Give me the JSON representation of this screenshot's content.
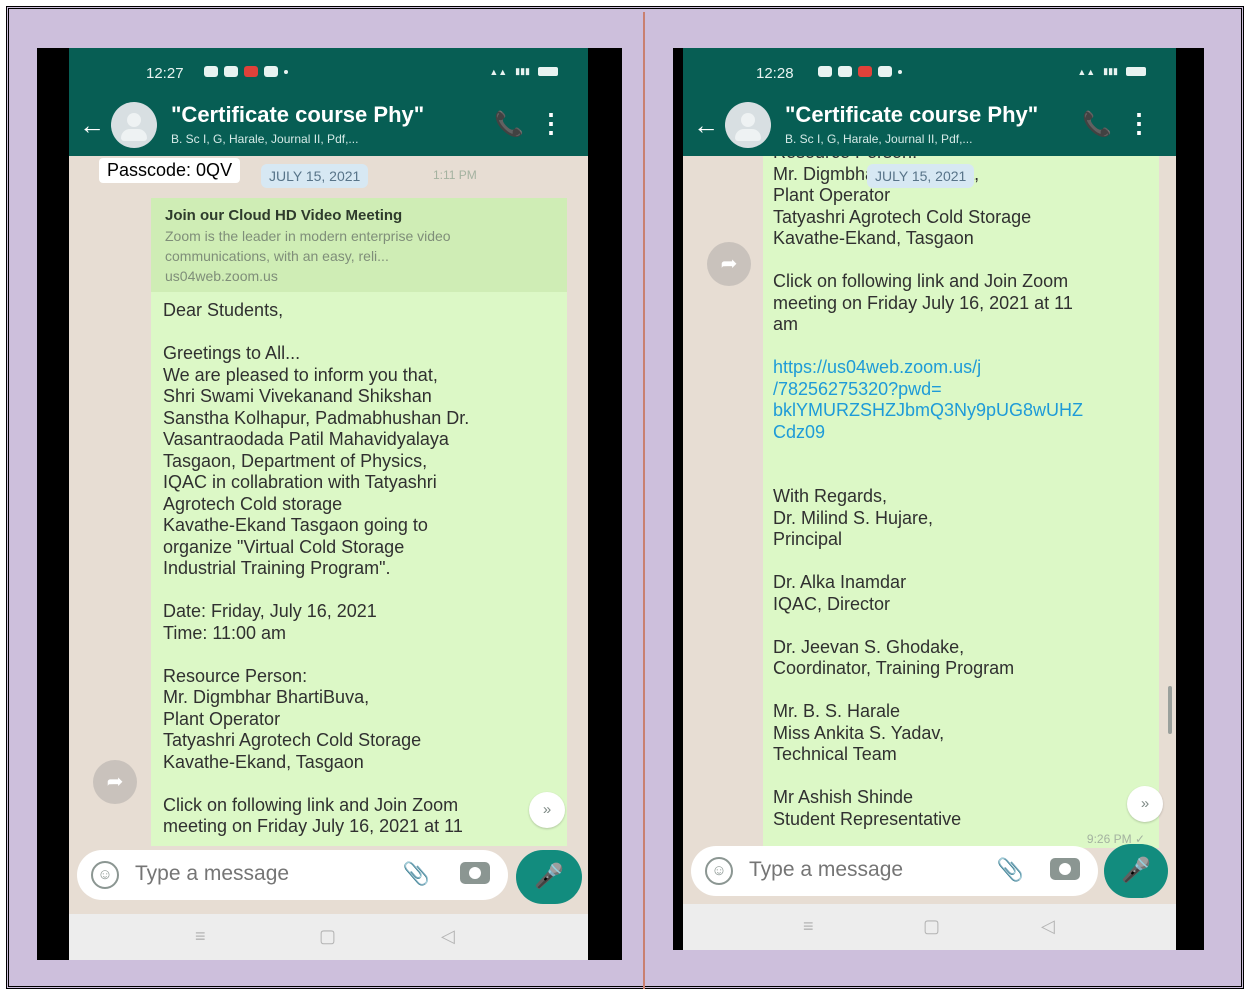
{
  "left": {
    "status_time": "12:27",
    "chat_title": "\"Certificate course Phy\"",
    "chat_subtitle": "B. Sc I, G, Harale, Journal II, Pdf,...",
    "passcode": "Passcode: 0QV",
    "date_chip": "JULY 15, 2021",
    "chip_time": "1:11 PM",
    "preview_title": "Join our Cloud HD Video Meeting",
    "preview_desc": "Zoom is the leader in modern enterprise video communications, with an easy, reli...",
    "preview_domain": "us04web.zoom.us",
    "message_lines": [
      "Dear Students,",
      "",
      "Greetings to All...",
      "We are pleased to inform you that,",
      "Shri Swami Vivekanand Shikshan",
      "Sanstha Kolhapur, Padmabhushan Dr.",
      "Vasantraodada Patil Mahavidyalaya",
      "Tasgaon, Department of Physics,",
      "IQAC in collabration with Tatyashri",
      "Agrotech Cold storage",
      "Kavathe-Ekand Tasgaon  going to",
      "organize \"Virtual Cold Storage",
      "Industrial Training Program\".",
      "",
      "Date: Friday, July 16, 2021",
      "Time: 11:00 am",
      "",
      "Resource Person:",
      "Mr. Digmbhar BhartiBuva,",
      "Plant Operator",
      "Tatyashri Agrotech Cold Storage",
      "Kavathe-Ekand, Tasgaon",
      "",
      "Click on following link and Join Zoom",
      "meeting on Friday July 16, 2021 at 11"
    ],
    "input_placeholder": "Type a message"
  },
  "right": {
    "status_time": "12:28",
    "chat_title": "\"Certificate course Phy\"",
    "chat_subtitle": "B. Sc I, G, Harale, Journal II, Pdf,...",
    "date_chip": "JULY 15, 2021",
    "message_lines": [
      "Resource Person:",
      "Mr. Digmbhar BhartiBuva,",
      "Plant Operator",
      "Tatyashri Agrotech Cold Storage",
      "Kavathe-Ekand, Tasgaon",
      "",
      "Click on following link and Join Zoom",
      "meeting on Friday July 16, 2021 at 11",
      "am",
      ""
    ],
    "link_lines": [
      "https://us04web.zoom.us/j",
      "/78256275320?pwd=",
      "bklYMURZSHZJbmQ3Ny9pUG8wUHZ",
      "Cdz09"
    ],
    "closing_lines": [
      "",
      "",
      "With Regards,",
      "Dr. Milind S. Hujare,",
      "Principal",
      "",
      "Dr. Alka Inamdar",
      "IQAC, Director",
      "",
      "Dr. Jeevan S. Ghodake,",
      "Coordinator, Training Program",
      "",
      "Mr. B. S. Harale",
      "Miss Ankita S. Yadav,",
      "Technical Team",
      "",
      "Mr Ashish Shinde",
      "Student Representative"
    ],
    "message_time": "9:26 PM ✓",
    "input_placeholder": "Type a message"
  },
  "icons": {
    "back": "←",
    "call": "📞",
    "menu": "⋮",
    "forward": "➦",
    "scroll_down": "»",
    "attach": "📎",
    "mic": "🎤",
    "emoji": "☺",
    "nav_menu": "≡",
    "nav_home": "▢",
    "nav_back": "◁"
  },
  "colors": {
    "header": "#075e54",
    "bubble": "#dcf8c6",
    "chat_bg": "#e7ddd3",
    "link": "#1e9bd8",
    "mic_button": "#128c7e",
    "frame_bg": "#cdbfdc"
  }
}
